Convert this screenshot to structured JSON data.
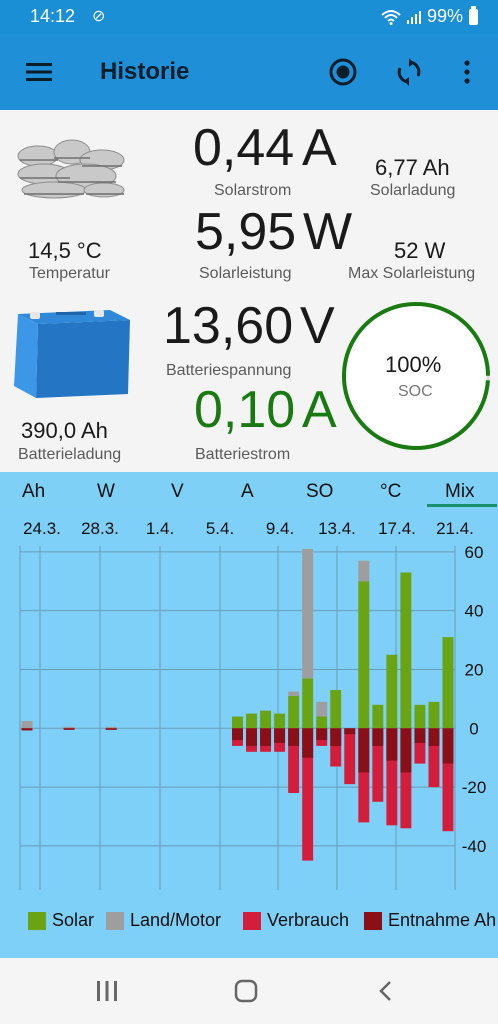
{
  "status": {
    "time": "14:12",
    "battery": "99%"
  },
  "appbar": {
    "title": "Historie"
  },
  "stats": {
    "solarstrom_value": "0,44",
    "solarstrom_unit": "A",
    "solarstrom_label": "Solarstrom",
    "solarladung_value": "6,77 Ah",
    "solarladung_label": "Solarladung",
    "solarleistung_value": "5,95",
    "solarleistung_unit": "W",
    "solarleistung_label": "Solarleistung",
    "temperatur_value": "14,5 °C",
    "temperatur_label": "Temperatur",
    "max_solarleistung_value": "52 W",
    "max_solarleistung_label": "Max Solarleistung",
    "batteriespannung_value": "13,60",
    "batteriespannung_unit": "V",
    "batteriespannung_label": "Batteriespannung",
    "batteriestrom_value": "0,10",
    "batteriestrom_unit": "A",
    "batteriestrom_label": "Batteriestrom",
    "batterieladung_value": "390,0 Ah",
    "batterieladung_label": "Batterieladung",
    "soc_value": "100%",
    "soc_label": "SOC",
    "soc_fraction": 0.99
  },
  "tabs": [
    {
      "label": "Ah"
    },
    {
      "label": "W"
    },
    {
      "label": "V"
    },
    {
      "label": "A"
    },
    {
      "label": "SO"
    },
    {
      "label": "°C"
    },
    {
      "label": "Mix",
      "selected": true
    }
  ],
  "colors": {
    "solar": "#6aa412",
    "land_motor": "#9e9e9e",
    "verbrauch": "#d41d3a",
    "entnahme": "#8b0f16",
    "chart_bg": "#7fd0f8",
    "appbar": "#1f8fd8"
  },
  "chart_data": {
    "type": "bar",
    "date_labels": [
      "24.3.",
      "28.3.",
      "1.4.",
      "5.4.",
      "9.4.",
      "13.4.",
      "17.4.",
      "21.4."
    ],
    "y_ticks": [
      "60",
      "40",
      "20",
      "0",
      "-20",
      "-40"
    ],
    "ylim": [
      -55,
      62
    ],
    "legend": [
      "Solar",
      "Land/Motor",
      "Verbrauch",
      "Entnahme Ah"
    ],
    "days": [
      {
        "solar": 0,
        "land": 2.5,
        "verbrauch": -0.7,
        "entnahme": -0.7
      },
      {
        "solar": 0,
        "land": 0,
        "verbrauch": 0,
        "entnahme": 0
      },
      {
        "solar": 0,
        "land": 0,
        "verbrauch": 0,
        "entnahme": 0
      },
      {
        "solar": 0,
        "land": 0.5,
        "verbrauch": -0.5,
        "entnahme": -0.5
      },
      {
        "solar": 0,
        "land": 0,
        "verbrauch": 0,
        "entnahme": 0
      },
      {
        "solar": 0,
        "land": 0,
        "verbrauch": 0,
        "entnahme": 0
      },
      {
        "solar": 0,
        "land": 0.5,
        "verbrauch": -0.5,
        "entnahme": -0.5
      },
      {
        "solar": 0,
        "land": 0,
        "verbrauch": 0,
        "entnahme": 0
      },
      {
        "solar": 0,
        "land": 0,
        "verbrauch": 0,
        "entnahme": 0
      },
      {
        "solar": 0,
        "land": 0,
        "verbrauch": 0,
        "entnahme": 0
      },
      {
        "solar": 0,
        "land": 0,
        "verbrauch": 0,
        "entnahme": 0
      },
      {
        "solar": 0,
        "land": 0,
        "verbrauch": 0,
        "entnahme": 0
      },
      {
        "solar": 0,
        "land": 0,
        "verbrauch": 0,
        "entnahme": 0
      },
      {
        "solar": 0,
        "land": 0,
        "verbrauch": 0,
        "entnahme": 0
      },
      {
        "solar": 0,
        "land": 0,
        "verbrauch": 0,
        "entnahme": 0
      },
      {
        "solar": 4,
        "land": 0,
        "verbrauch": -6,
        "entnahme": -4
      },
      {
        "solar": 5,
        "land": 0,
        "verbrauch": -8,
        "entnahme": -6
      },
      {
        "solar": 6,
        "land": 0,
        "verbrauch": -8,
        "entnahme": -6
      },
      {
        "solar": 5,
        "land": 0,
        "verbrauch": -8,
        "entnahme": -5
      },
      {
        "solar": 11,
        "land": 1.5,
        "verbrauch": -22,
        "entnahme": -6
      },
      {
        "solar": 17,
        "land": 44,
        "verbrauch": -45,
        "entnahme": -10
      },
      {
        "solar": 4,
        "land": 5,
        "verbrauch": -6,
        "entnahme": -4
      },
      {
        "solar": 13,
        "land": 0,
        "verbrauch": -13,
        "entnahme": -6
      },
      {
        "solar": 0,
        "land": 0,
        "verbrauch": -19,
        "entnahme": -2
      },
      {
        "solar": 50,
        "land": 7,
        "verbrauch": -32,
        "entnahme": -15
      },
      {
        "solar": 8,
        "land": 0,
        "verbrauch": -25,
        "entnahme": -6
      },
      {
        "solar": 25,
        "land": 0,
        "verbrauch": -33,
        "entnahme": -11
      },
      {
        "solar": 53,
        "land": 0,
        "verbrauch": -34,
        "entnahme": -15
      },
      {
        "solar": 8,
        "land": 0,
        "verbrauch": -12,
        "entnahme": -5
      },
      {
        "solar": 9,
        "land": 0,
        "verbrauch": -20,
        "entnahme": -6
      },
      {
        "solar": 31,
        "land": 0,
        "verbrauch": -35,
        "entnahme": -12
      }
    ]
  },
  "nav": {
    "recent": "recent-apps",
    "home": "home",
    "back": "back"
  }
}
